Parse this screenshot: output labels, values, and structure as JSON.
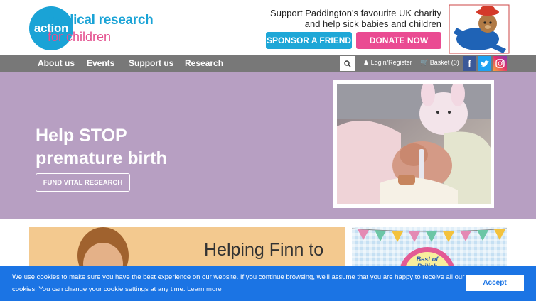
{
  "brand": {
    "logo_circle": "action",
    "logo_line1": "medical research",
    "logo_line2": "for children",
    "primary_color": "#1aa3d6",
    "accent_color": "#e4508f"
  },
  "header": {
    "tagline_line1": "Support Paddington's favourite UK charity",
    "tagline_line2": "and help sick babies and children",
    "sponsor_label": "SPONSOR A FRIEND",
    "donate_label": "DONATE NOW",
    "mascot_icon": "paddington-bear-icon"
  },
  "nav": {
    "items": [
      {
        "label": "About us"
      },
      {
        "label": "Events"
      },
      {
        "label": "Support us"
      },
      {
        "label": "Research"
      }
    ],
    "search_icon": "search-icon",
    "login_label": "Login/Register",
    "basket_label": "Basket (0)",
    "social": {
      "facebook": "f",
      "twitter": "twitter-icon",
      "instagram": "instagram-icon"
    }
  },
  "hero": {
    "title_line1": "Help STOP",
    "title_line2": "premature birth",
    "button_label": "FUND VITAL RESEARCH",
    "background": "#b79fc2"
  },
  "panels": {
    "left_text": "Helping Finn to",
    "right_badge": "Best of British"
  },
  "cookie": {
    "text": "We use cookies to make sure you have the best experience on our website. If you continue browsing, we'll assume that you are happy to receive all our cookies. You can change your cookie settings at any time.",
    "link_label": "Learn more",
    "accept_label": "Accept",
    "background": "#1b74e4"
  }
}
